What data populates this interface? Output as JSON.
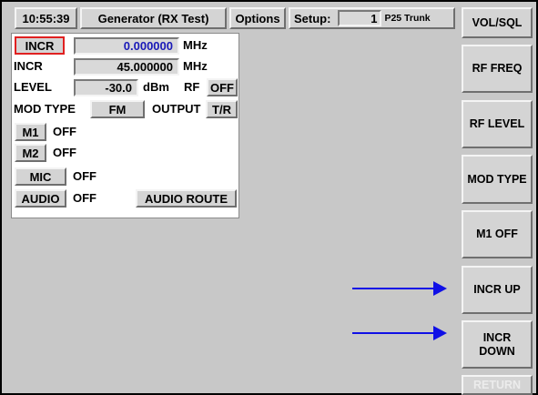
{
  "header": {
    "time": "10:55:39",
    "title": "Generator (RX Test)",
    "options_label": "Options",
    "setup_label": "Setup:",
    "setup_number": "1",
    "setup_name": "P25 Trunk"
  },
  "generator": {
    "incr_button": "INCR",
    "incr_value": "0.000000",
    "incr_unit": "MHz",
    "incr2_label": "INCR",
    "incr2_value": "45.000000",
    "incr2_unit": "MHz",
    "level_label": "LEVEL",
    "level_value": "-30.0",
    "level_unit": "dBm",
    "rf_label": "RF",
    "rf_state": "OFF",
    "mod_type_label": "MOD TYPE",
    "mod_type_value": "FM",
    "output_label": "OUTPUT",
    "output_value": "T/R",
    "m1_button": "M1",
    "m1_state": "OFF",
    "m2_button": "M2",
    "m2_state": "OFF",
    "mic_button": "MIC",
    "mic_state": "OFF",
    "audio_button": "AUDIO",
    "audio_state": "OFF",
    "audio_route_button": "AUDIO ROUTE"
  },
  "softkeys": [
    {
      "label": "VOL/SQL"
    },
    {
      "label": "RF FREQ"
    },
    {
      "label": "RF LEVEL"
    },
    {
      "label": "MOD TYPE"
    },
    {
      "label": "M1 OFF"
    },
    {
      "label": "INCR UP"
    },
    {
      "label": "INCR\nDOWN"
    },
    {
      "label": "RETURN"
    }
  ],
  "colors": {
    "background": "#c8c8c8",
    "highlight_border": "#e02020",
    "value_blue": "#1a1ab8",
    "annotation_arrow": "#1010e6"
  }
}
